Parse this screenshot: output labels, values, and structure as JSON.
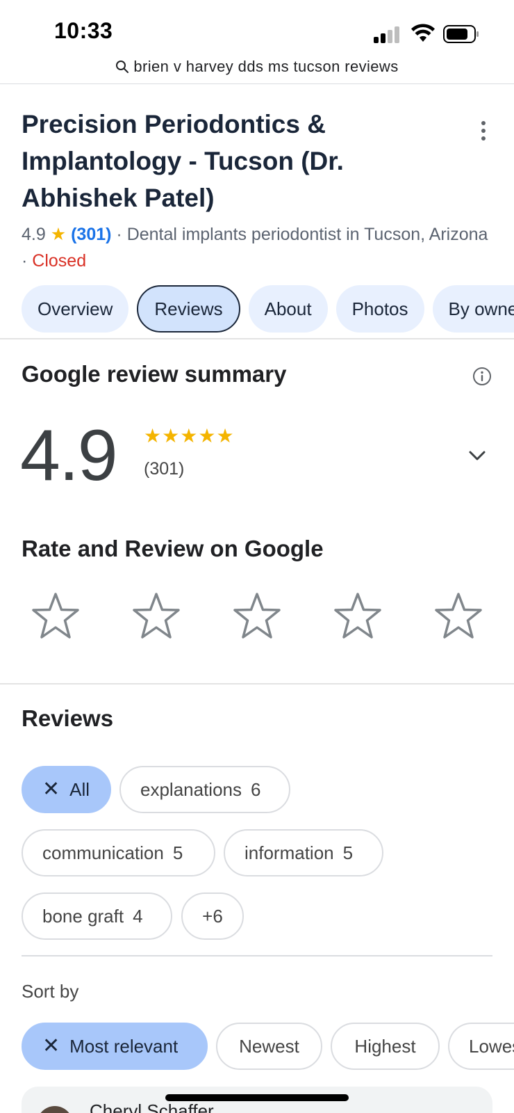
{
  "status_bar": {
    "time": "10:33"
  },
  "search": {
    "query": "brien v harvey dds ms tucson reviews"
  },
  "business": {
    "title": "Precision Periodontics & Implantology - Tucson (Dr. Abhishek Patel)",
    "rating": "4.9",
    "star": "★",
    "review_count": "(301)",
    "separator": " · ",
    "category": "Dental implants periodontist in Tucson, Arizona",
    "status": "Closed"
  },
  "tabs": [
    {
      "label": "Overview",
      "active": false
    },
    {
      "label": "Reviews",
      "active": true
    },
    {
      "label": "About",
      "active": false
    },
    {
      "label": "Photos",
      "active": false
    },
    {
      "label": "By owner",
      "active": false
    }
  ],
  "summary": {
    "title": "Google review summary",
    "rating": "4.9",
    "stars": "★★★★★",
    "count": "(301)",
    "stars_filled": 5
  },
  "rate": {
    "title": "Rate and Review on Google",
    "star_count": 5
  },
  "reviews": {
    "title": "Reviews",
    "topic_chips": [
      {
        "label": "All",
        "count": "",
        "selected": true
      },
      {
        "label": "explanations",
        "count": "6",
        "selected": false
      },
      {
        "label": "communication",
        "count": "5",
        "selected": false
      },
      {
        "label": "information",
        "count": "5",
        "selected": false
      },
      {
        "label": "bone graft",
        "count": "4",
        "selected": false
      },
      {
        "label": "+6",
        "count": "",
        "selected": false
      }
    ],
    "sort_label": "Sort by",
    "sort_chips": [
      {
        "label": "Most relevant",
        "selected": true
      },
      {
        "label": "Newest",
        "selected": false
      },
      {
        "label": "Highest",
        "selected": false
      },
      {
        "label": "Lowest",
        "selected": false
      }
    ],
    "first_reviewer": "Cheryl Schaffer"
  },
  "colors": {
    "accent_blue": "#1a73e8",
    "star_gold": "#f4b400",
    "closed_red": "#d93025",
    "chip_selected": "#a8c7fa",
    "tab_bg": "#e8f0fe"
  },
  "icons": {
    "search": "search-icon",
    "info": "info-icon",
    "chevron": "chevron-down-icon",
    "menu": "more-vert-icon",
    "clear": "close-icon",
    "rate_star": "star-outline-icon"
  }
}
